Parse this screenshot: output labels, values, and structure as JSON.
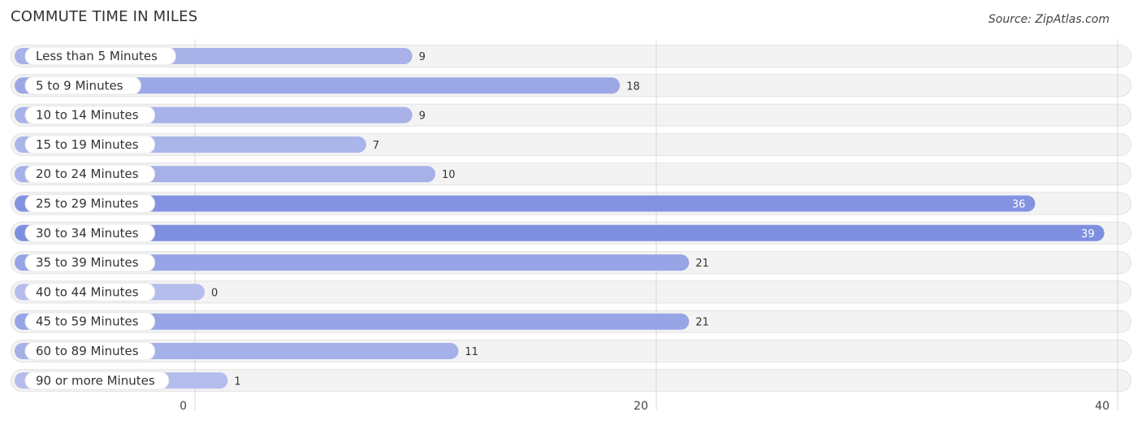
{
  "chart_data": {
    "type": "bar",
    "orientation": "horizontal",
    "title": "COMMUTE TIME IN MILES",
    "source": "Source: ZipAtlas.com",
    "categories": [
      "Less than 5 Minutes",
      "5 to 9 Minutes",
      "10 to 14 Minutes",
      "15 to 19 Minutes",
      "20 to 24 Minutes",
      "25 to 29 Minutes",
      "30 to 34 Minutes",
      "35 to 39 Minutes",
      "40 to 44 Minutes",
      "45 to 59 Minutes",
      "60 to 89 Minutes",
      "90 or more Minutes"
    ],
    "values": [
      9,
      18,
      9,
      7,
      10,
      36,
      39,
      21,
      0,
      21,
      11,
      1
    ],
    "xlim": [
      0,
      40
    ],
    "xticks": [
      "0",
      "20",
      "40"
    ],
    "xtick_values": [
      0,
      20,
      40
    ],
    "grid": true,
    "colors": {
      "bar_light": "#b4bdec",
      "bar_dark": "#7f8fe0",
      "track": "#f3f3f3"
    }
  }
}
